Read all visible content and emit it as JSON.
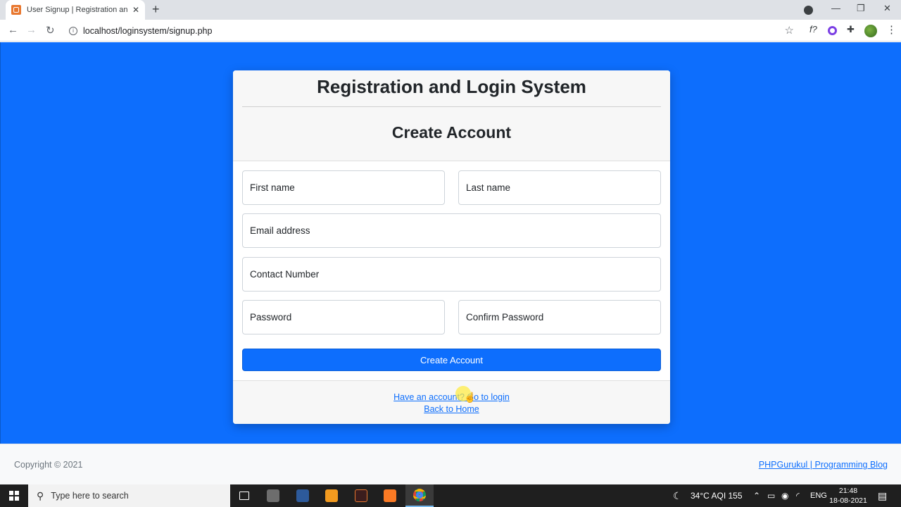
{
  "browser": {
    "tab_title": "User Signup | Registration and Login",
    "tab_close": "✕",
    "new_tab": "+",
    "url": "localhost/loginsystem/signup.php",
    "back": "←",
    "forward": "→",
    "reload": "↻",
    "info": "i",
    "star": "☆",
    "ext_f": "f?",
    "ext_puzzle": "✚",
    "menu": "⋮",
    "minimize": "—",
    "maximize": "❐",
    "close": "✕"
  },
  "header": {
    "site_title": "Registration and Login System",
    "card_title": "Create Account"
  },
  "form": {
    "first_name": "First name",
    "last_name": "Last name",
    "email": "Email address",
    "contact": "Contact Number",
    "password": "Password",
    "confirm_password": "Confirm Password",
    "submit": "Create Account"
  },
  "card_footer": {
    "login_link": "Have an account? Go to login",
    "home_link": "Back to Home"
  },
  "site_footer": {
    "copyright": "Copyright © 2021",
    "blog_link": "PHPGurukul | Programming Blog"
  },
  "taskbar": {
    "search_placeholder": "Type here to search",
    "weather": "34°C  AQI 155",
    "language": "ENG",
    "time": "21:48",
    "date": "18-08-2021"
  },
  "colors": {
    "page_bg": "#0d6efd",
    "button": "#0d6efd",
    "link": "#0d6efd"
  }
}
